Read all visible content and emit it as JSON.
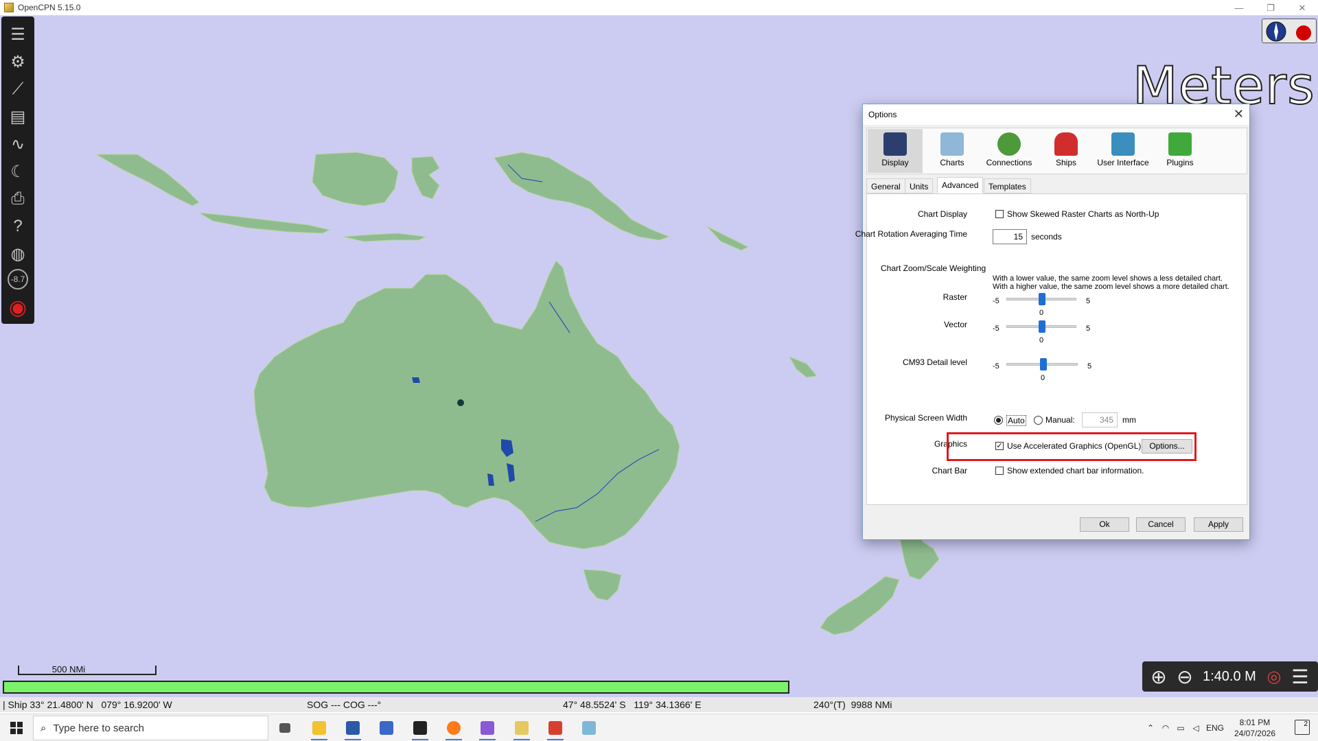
{
  "window": {
    "title": "OpenCPN 5.15.0",
    "controls": [
      "—",
      "❐",
      "✕"
    ]
  },
  "map": {
    "overlay_unit": "Meters",
    "scale_bar_label": "500 NMi",
    "zoom_scale": "1:40.0 M"
  },
  "toolbar": {
    "items": [
      {
        "name": "menu-icon",
        "glyph": "☰"
      },
      {
        "name": "settings-icon",
        "glyph": "⚙"
      },
      {
        "name": "route-icon",
        "glyph": "⟋"
      },
      {
        "name": "route-manager-icon",
        "glyph": "▤"
      },
      {
        "name": "track-icon",
        "glyph": "∿"
      },
      {
        "name": "day-night-icon",
        "glyph": "☾"
      },
      {
        "name": "print-icon",
        "glyph": "⎙"
      },
      {
        "name": "help-icon",
        "glyph": "?"
      },
      {
        "name": "globe-icon",
        "glyph": "◍"
      },
      {
        "name": "tide-icon",
        "glyph": "-8.7"
      },
      {
        "name": "mob-icon",
        "glyph": "◉"
      }
    ]
  },
  "status": {
    "ship": "| Ship 33° 21.4800' N   079° 16.9200' W",
    "sog_cog": "SOG --- COG ---°",
    "cursor": "47° 48.5524' S   119° 34.1366' E",
    "bearing": "240°(T)  9988 NMi"
  },
  "dialog": {
    "title": "Options",
    "close": "✕",
    "tabs": [
      {
        "label": "Display",
        "color": "#2b3e6e"
      },
      {
        "label": "Charts",
        "color": "#8fb7d8"
      },
      {
        "label": "Connections",
        "color": "#4c9a3a"
      },
      {
        "label": "Ships",
        "color": "#d12d2d"
      },
      {
        "label": "User Interface",
        "color": "#3a8fbf"
      },
      {
        "label": "Plugins",
        "color": "#3faa3a"
      }
    ],
    "subtabs": [
      "General",
      "Units",
      "Advanced",
      "Templates"
    ],
    "chart_display": {
      "label": "Chart Display",
      "option": "Show Skewed Raster Charts as North-Up",
      "checked": false
    },
    "rotation": {
      "label": "Chart Rotation Averaging Time",
      "value": "15",
      "unit": "seconds"
    },
    "zoom": {
      "label": "Chart Zoom/Scale Weighting",
      "note1": "With a lower value, the same zoom level shows a less detailed chart.",
      "note2": "With a higher value, the same zoom level shows a more detailed chart.",
      "sliders": [
        {
          "label": "Raster",
          "min": "-5",
          "max": "5",
          "value": "0"
        },
        {
          "label": "Vector",
          "min": "-5",
          "max": "5",
          "value": "0"
        },
        {
          "label": "CM93 Detail level",
          "min": "-5",
          "max": "5",
          "value": "0"
        }
      ]
    },
    "screen_width": {
      "label": "Physical Screen Width",
      "auto": "Auto",
      "manual": "Manual:",
      "value": "345",
      "unit": "mm",
      "selected": "auto"
    },
    "graphics": {
      "label": "Graphics",
      "option": "Use Accelerated Graphics (OpenGL)",
      "checked": true,
      "button": "Options..."
    },
    "chart_bar": {
      "label": "Chart Bar",
      "option": "Show extended chart bar information.",
      "checked": false
    },
    "buttons": {
      "ok": "Ok",
      "cancel": "Cancel",
      "apply": "Apply"
    }
  },
  "taskbar": {
    "search_placeholder": "Type here to search",
    "language": "ENG",
    "time": "8:01 PM",
    "date": "24/07/2026",
    "notifications": "2",
    "apps": [
      {
        "name": "task-view-icon",
        "color": "#555555"
      },
      {
        "name": "file-explorer-icon",
        "color": "#f2c230"
      },
      {
        "name": "powershell-icon",
        "color": "#2a5aa8"
      },
      {
        "name": "remote-desktop-icon",
        "color": "#3b67c7"
      },
      {
        "name": "terminal-icon",
        "color": "#222222"
      },
      {
        "name": "firefox-icon",
        "color": "#ff7a1a"
      },
      {
        "name": "visual-studio-icon",
        "color": "#8a5ad6"
      },
      {
        "name": "opencpn-icon",
        "color": "#e6c860"
      },
      {
        "name": "app-icon",
        "color": "#d8402d"
      },
      {
        "name": "notes-icon",
        "color": "#7fb7d8"
      }
    ]
  }
}
